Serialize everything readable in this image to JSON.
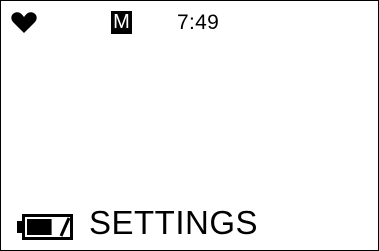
{
  "status_bar": {
    "heart_icon": "heart-icon",
    "mode_badge": "M",
    "clock": "7:49"
  },
  "bottom_bar": {
    "battery_icon": "battery-icon",
    "battery_level": 0.6,
    "menu_label": "SETTINGS"
  },
  "colors": {
    "foreground": "#000000",
    "background": "#ffffff"
  }
}
